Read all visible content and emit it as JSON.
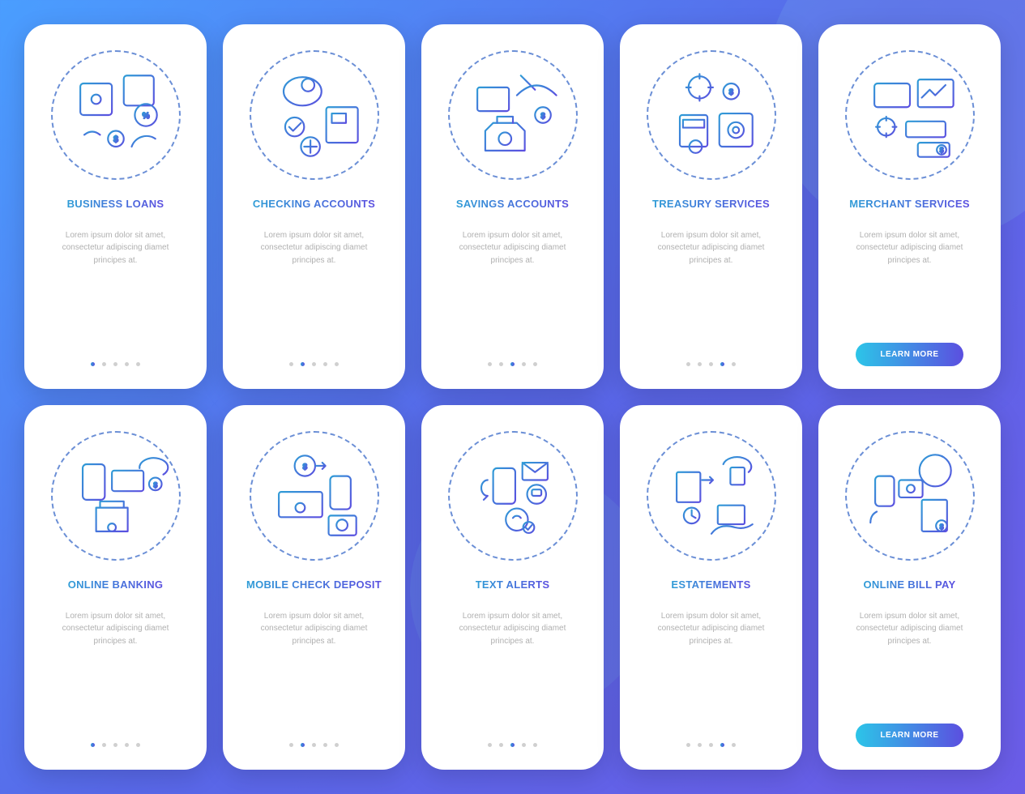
{
  "desc": "Lorem ipsum dolor sit amet, consectetur adipiscing diamet principes at.",
  "learn_more": "LEARN MORE",
  "cards": [
    {
      "title": "BUSINESS LOANS",
      "active": 0,
      "btn": false
    },
    {
      "title": "CHECKING ACCOUNTS",
      "active": 1,
      "btn": false
    },
    {
      "title": "SAVINGS ACCOUNTS",
      "active": 2,
      "btn": false
    },
    {
      "title": "TREASURY SERVICES",
      "active": 3,
      "btn": false
    },
    {
      "title": "MERCHANT SERVICES",
      "active": -1,
      "btn": true
    },
    {
      "title": "ONLINE BANKING",
      "active": 0,
      "btn": false
    },
    {
      "title": "MOBILE CHECK DEPOSIT",
      "active": 1,
      "btn": false
    },
    {
      "title": "TEXT ALERTS",
      "active": 2,
      "btn": false
    },
    {
      "title": "ESTATEMENTS",
      "active": 3,
      "btn": false
    },
    {
      "title": "ONLINE BILL PAY",
      "active": -1,
      "btn": true
    }
  ],
  "icons": [
    "business-loans-icon",
    "checking-accounts-icon",
    "savings-accounts-icon",
    "treasury-services-icon",
    "merchant-services-icon",
    "online-banking-icon",
    "mobile-check-deposit-icon",
    "text-alerts-icon",
    "estatements-icon",
    "online-bill-pay-icon"
  ]
}
